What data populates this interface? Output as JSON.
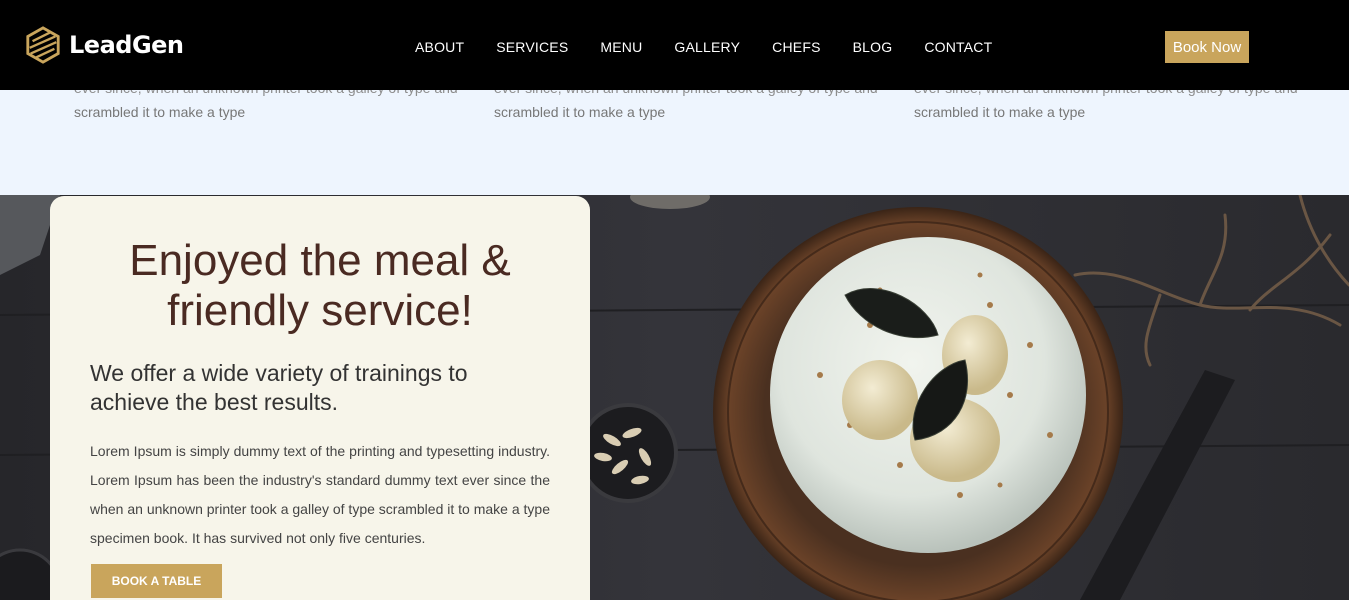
{
  "header": {
    "brand": "LeadGen",
    "nav": [
      "ABOUT",
      "SERVICES",
      "MENU",
      "GALLERY",
      "CHEFS",
      "BLOG",
      "CONTACT"
    ],
    "cta": "Book Now"
  },
  "strip": {
    "columns": [
      {
        "line1": "ever since, when an unknown printer took a galley of type and",
        "line2": "scrambled it to make a type"
      },
      {
        "line1": "ever since, when an unknown printer took a galley of type and",
        "line2": "scrambled it to make a type"
      },
      {
        "line1": "ever since, when an unknown printer took a galley of type and",
        "line2": "scrambled it to make a type"
      }
    ]
  },
  "promo": {
    "title": "Enjoyed the meal & friendly service!",
    "subtitle": "We offer a wide variety of trainings to achieve the best results.",
    "body": "Lorem Ipsum is simply dummy text of the printing and typesetting industry. Lorem Ipsum has been the industry's standard dummy text ever since the when an unknown printer took a galley of type scrambled it to make a type specimen book. It has survived not only five centuries.",
    "button": "BOOK A TABLE"
  },
  "colors": {
    "header_bg": "#000000",
    "accent": "#c9a55c",
    "strip_bg": "#eef5fe",
    "card_bg": "#f7f5ea",
    "title_color": "#4a2a22"
  }
}
